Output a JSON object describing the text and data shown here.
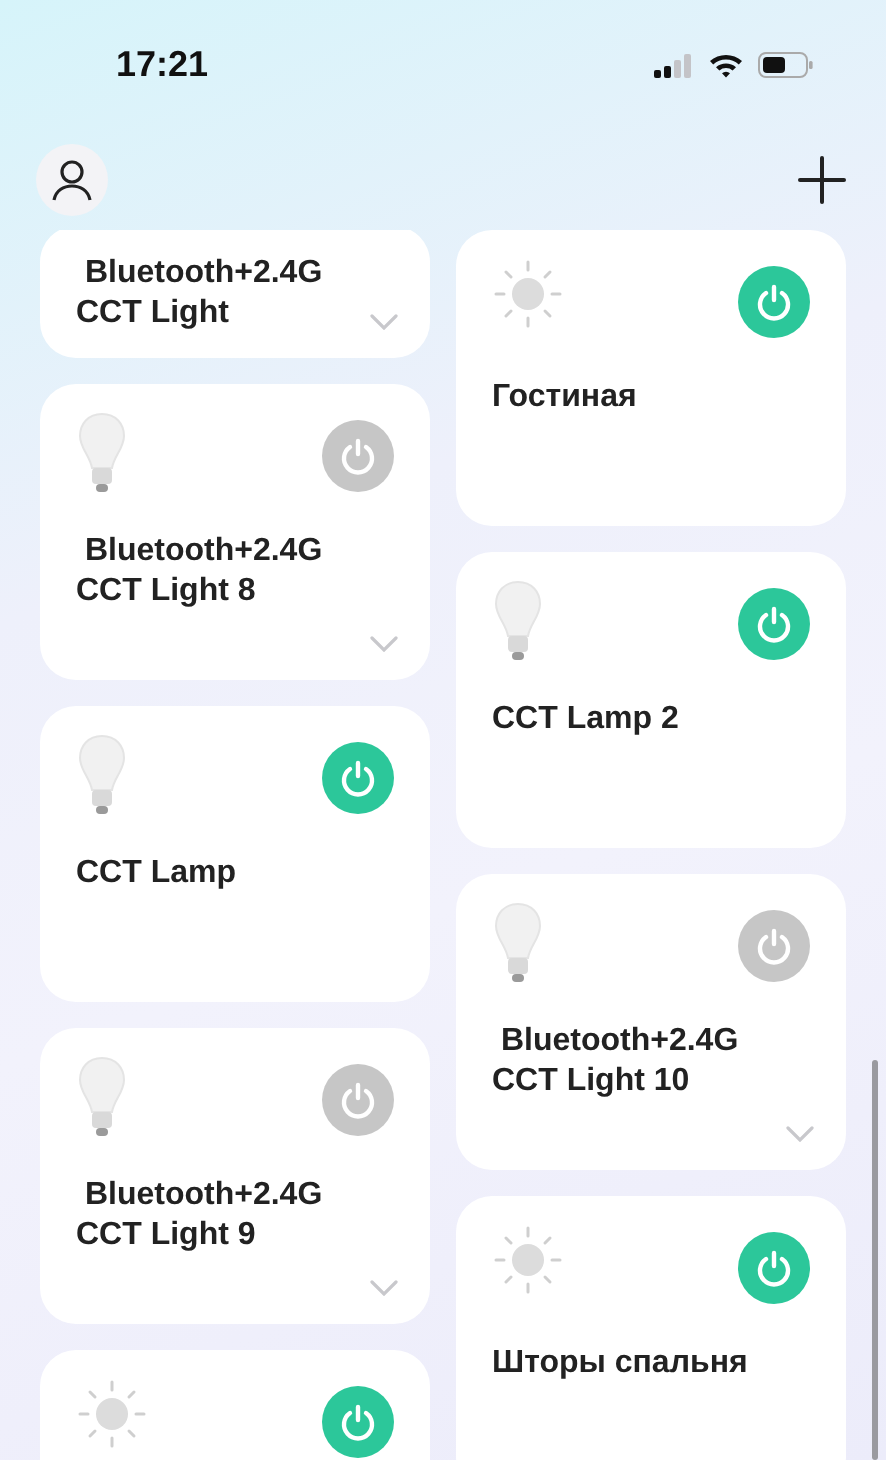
{
  "status_bar": {
    "time": "17:21"
  },
  "columns": [
    [
      {
        "name": " Bluetooth+2.4G\nCCT Light",
        "expandable": true
      },
      {
        "kind": "bulb",
        "on": false,
        "name": " Bluetooth+2.4G\nCCT Light 8",
        "expandable": true
      },
      {
        "kind": "bulb",
        "on": true,
        "name": "CCT Lamp",
        "expandable": false
      },
      {
        "kind": "bulb",
        "on": false,
        "name": " Bluetooth+2.4G\nCCT Light 9",
        "expandable": true
      },
      {
        "kind": "sun",
        "on": true
      }
    ],
    [
      {
        "kind": "sun",
        "on": true,
        "name": "Гостиная",
        "expandable": false
      },
      {
        "kind": "bulb",
        "on": true,
        "name": "CCT Lamp 2",
        "expandable": false
      },
      {
        "kind": "bulb",
        "on": false,
        "name": " Bluetooth+2.4G\nCCT Light 10",
        "expandable": true
      },
      {
        "kind": "sun",
        "on": true,
        "name": "Шторы спальня",
        "expandable": false
      }
    ]
  ]
}
